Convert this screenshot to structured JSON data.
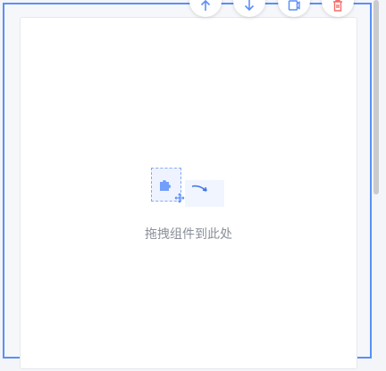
{
  "toolbar": {
    "buttons": [
      {
        "name": "move-up",
        "icon": "arrow-up-icon"
      },
      {
        "name": "move-down",
        "icon": "arrow-down-icon"
      },
      {
        "name": "copy",
        "icon": "copy-icon"
      },
      {
        "name": "delete",
        "icon": "trash-icon"
      }
    ]
  },
  "placeholder": {
    "text": "拖拽组件到此处",
    "icon": "puzzle-icon"
  },
  "colors": {
    "selection_border": "#5b8ff9",
    "accent": "#5b8ff9",
    "delete": "#f56c6c",
    "hint_text": "#8a8f99"
  }
}
